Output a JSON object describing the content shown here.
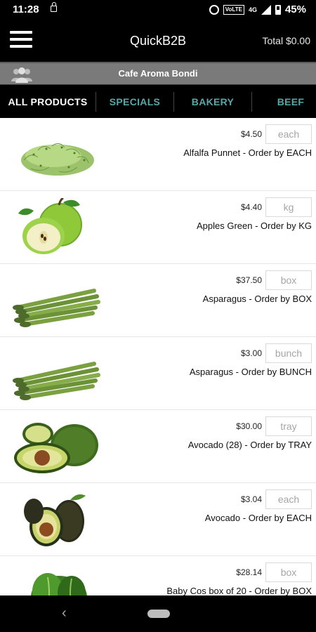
{
  "status_bar": {
    "time": "11:28",
    "network": "4G",
    "volte": "VoLTE",
    "battery": "45%",
    "icons": [
      "lock-icon",
      "alarm-icon",
      "volte-icon",
      "signal-icon",
      "battery-icon"
    ]
  },
  "header": {
    "menu_icon": "hamburger-menu-icon",
    "title": "QuickB2B",
    "total": "Total $0.00"
  },
  "customer": {
    "icon": "users-icon",
    "name": "Cafe Aroma Bondi"
  },
  "tabs": [
    {
      "label": "ALL PRODUCTS",
      "active": true
    },
    {
      "label": "SPECIALS",
      "active": false
    },
    {
      "label": "BAKERY",
      "active": false
    },
    {
      "label": "BEEF",
      "active": false
    }
  ],
  "products": [
    {
      "price": "$4.50",
      "unit": "each",
      "name": "Alfalfa Punnet - Order by EACH",
      "image": "alfalfa-sprouts"
    },
    {
      "price": "$4.40",
      "unit": "kg",
      "name": "Apples Green - Order by KG",
      "image": "green-apples"
    },
    {
      "price": "$37.50",
      "unit": "box",
      "name": "Asparagus - Order by BOX",
      "image": "asparagus"
    },
    {
      "price": "$3.00",
      "unit": "bunch",
      "name": "Asparagus - Order by BUNCH",
      "image": "asparagus"
    },
    {
      "price": "$30.00",
      "unit": "tray",
      "name": "Avocado (28) - Order by TRAY",
      "image": "avocado"
    },
    {
      "price": "$3.04",
      "unit": "each",
      "name": "Avocado - Order by EACH",
      "image": "avocado"
    },
    {
      "price": "$28.14",
      "unit": "box",
      "name": "Baby Cos box of 20 - Order by BOX",
      "image": "baby-cos-lettuce"
    }
  ],
  "nav": {
    "back_icon": "back-chevron-icon",
    "home_icon": "home-pill-icon"
  },
  "colors": {
    "header_bg": "#000000",
    "customer_bar_bg": "#7a7a7a",
    "tab_inactive": "#56a8a8",
    "tab_active": "#ffffff"
  }
}
